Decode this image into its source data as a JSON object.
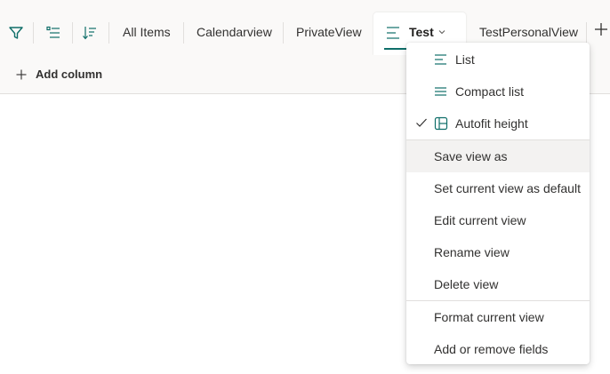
{
  "toolbar": {
    "filter_icon": "filter-icon",
    "group_icon": "group-by-icon",
    "sort_icon": "sort-icon"
  },
  "views": {
    "tabs": [
      "All Items",
      "Calendarview",
      "PrivateView"
    ],
    "active_tab": "Test",
    "after_tab": "TestPersonalView"
  },
  "command": {
    "add_column": "Add column"
  },
  "menu": {
    "list": "List",
    "compact_list": "Compact list",
    "autofit_height": "Autofit height",
    "save_view_as": "Save view as",
    "set_default": "Set current view as default",
    "edit_view": "Edit current view",
    "rename_view": "Rename view",
    "delete_view": "Delete view",
    "format_view": "Format current view",
    "add_remove_fields": "Add or remove fields"
  },
  "colors": {
    "accent": "#0f6e69",
    "text": "#323130",
    "hover": "#f3f2f1"
  }
}
